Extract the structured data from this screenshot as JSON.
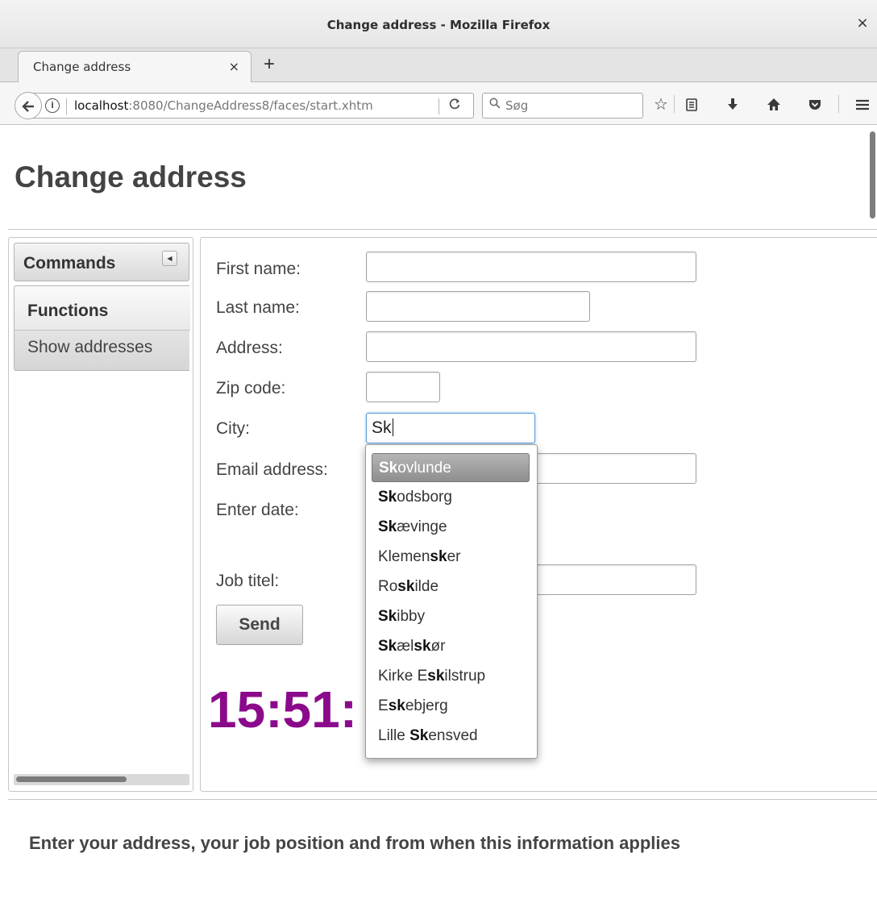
{
  "window": {
    "title": "Change address - Mozilla Firefox",
    "close_glyph": "×"
  },
  "tabs": [
    {
      "label": "Change address",
      "close_glyph": "×"
    }
  ],
  "new_tab_glyph": "+",
  "navbar": {
    "url_host": "localhost",
    "url_rest": ":8080/ChangeAddress8/faces/start.xhtm",
    "search_placeholder": "Søg",
    "icons": [
      "back-arrow-icon",
      "info-icon",
      "reload-icon",
      "search-icon",
      "bookmark-star-icon",
      "reading-list-icon",
      "download-icon",
      "home-icon",
      "pocket-icon",
      "hamburger-menu-icon"
    ]
  },
  "page": {
    "title": "Change address",
    "west": {
      "header": "Commands",
      "menu_heading": "Functions",
      "menu_items": [
        "Show addresses"
      ]
    },
    "form": {
      "labels": {
        "first_name": "First name:",
        "last_name": "Last name:",
        "address": "Address:",
        "zip": "Zip code:",
        "city": "City:",
        "email": "Email address:",
        "date": "Enter date:",
        "job": "Job titel:"
      },
      "values": {
        "first_name": "",
        "last_name": "",
        "address": "",
        "zip": "",
        "city": "Sk",
        "email": "",
        "job": ""
      },
      "send_label": "Send"
    },
    "clock_text": "15:51:",
    "autocomplete": {
      "query": "Sk",
      "selected_index": 0,
      "items": [
        [
          {
            "t": "Sk",
            "b": true
          },
          {
            "t": "ovlunde",
            "b": false
          }
        ],
        [
          {
            "t": "Sk",
            "b": true
          },
          {
            "t": "odsborg",
            "b": false
          }
        ],
        [
          {
            "t": "Sk",
            "b": true
          },
          {
            "t": "ævinge",
            "b": false
          }
        ],
        [
          {
            "t": "Klemen",
            "b": false
          },
          {
            "t": "sk",
            "b": true
          },
          {
            "t": "er",
            "b": false
          }
        ],
        [
          {
            "t": "Ro",
            "b": false
          },
          {
            "t": "sk",
            "b": true
          },
          {
            "t": "ilde",
            "b": false
          }
        ],
        [
          {
            "t": "Sk",
            "b": true
          },
          {
            "t": "ibby",
            "b": false
          }
        ],
        [
          {
            "t": "Sk",
            "b": true
          },
          {
            "t": "æl",
            "b": false
          },
          {
            "t": "sk",
            "b": true
          },
          {
            "t": "ør",
            "b": false
          }
        ],
        [
          {
            "t": "Kirke E",
            "b": false
          },
          {
            "t": "sk",
            "b": true
          },
          {
            "t": "ilstrup",
            "b": false
          }
        ],
        [
          {
            "t": "E",
            "b": false
          },
          {
            "t": "sk",
            "b": true
          },
          {
            "t": "ebjerg",
            "b": false
          }
        ],
        [
          {
            "t": "Lille ",
            "b": false
          },
          {
            "t": "Sk",
            "b": true
          },
          {
            "t": "ensved",
            "b": false
          }
        ]
      ]
    },
    "footer": "Enter your address, your job position and from when this information applies"
  },
  "colors": {
    "clock": "#8b0a8b",
    "focus_border": "#5a9bd5",
    "highlight": "#9e9e9e"
  }
}
